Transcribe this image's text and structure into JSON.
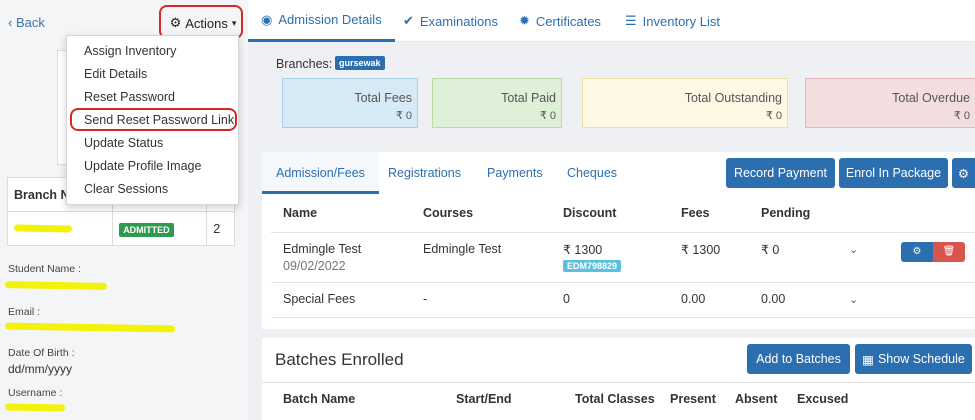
{
  "sidebar": {
    "back_label": "Back",
    "actions_label": "Actions",
    "branch_table": {
      "header": "Branch Na",
      "status": "ADMITTED",
      "count": "2"
    },
    "fields": [
      {
        "label": "Student Name :"
      },
      {
        "label": "Email :"
      },
      {
        "label": "Date Of Birth :",
        "value": "dd/mm/yyyy"
      },
      {
        "label": "Username :"
      }
    ]
  },
  "dropdown": {
    "items": [
      "Assign Inventory",
      "Edit Details",
      "Reset Password",
      "Send Reset Password Link",
      "Update Status",
      "Update Profile Image",
      "Clear Sessions"
    ]
  },
  "top_tabs": [
    "Admission Details",
    "Examinations",
    "Certificates",
    "Inventory List"
  ],
  "branches": {
    "label": "Branches:",
    "chip": "gursewak"
  },
  "summary_cards": [
    {
      "title": "Total Fees",
      "value": "₹ 0",
      "bg": "#d6eaf5",
      "border": "#a9cfe6"
    },
    {
      "title": "Total Paid",
      "value": "₹ 0",
      "bg": "#dff0d8",
      "border": "#b9dba9"
    },
    {
      "title": "Total Outstanding",
      "value": "₹ 0",
      "bg": "#fcf8e3",
      "border": "#eedfa8"
    },
    {
      "title": "Total Overdue",
      "value": "₹ 0",
      "bg": "#f2dede",
      "border": "#e3b9b9"
    }
  ],
  "sub_tabs": [
    "Admission/Fees",
    "Registrations",
    "Payments",
    "Cheques"
  ],
  "buttons": {
    "record_payment": "Record Payment",
    "enrol_package": "Enrol In Package",
    "add_batches": "Add to Batches",
    "show_schedule": "Show Schedule"
  },
  "fees_table": {
    "headers": [
      "Name",
      "Courses",
      "Discount",
      "Fees",
      "Pending"
    ],
    "rows": [
      {
        "name": "Edmingle Test",
        "date": "09/02/2022",
        "course": "Edmingle Test",
        "discount": "₹ 1300",
        "code": "EDM798829",
        "fees": "₹ 1300",
        "pending": "₹ 0"
      },
      {
        "name": "Special Fees",
        "course": "-",
        "discount": "0",
        "fees": "0.00",
        "pending": "0.00"
      }
    ]
  },
  "batches": {
    "title": "Batches Enrolled",
    "headers": [
      "Batch Name",
      "Start/End",
      "Total Classes",
      "Present",
      "Absent",
      "Excused"
    ]
  },
  "colors": {
    "accent": "#2c6fb0",
    "admitted": "#2d9b4f",
    "highlight": "#d62828"
  }
}
